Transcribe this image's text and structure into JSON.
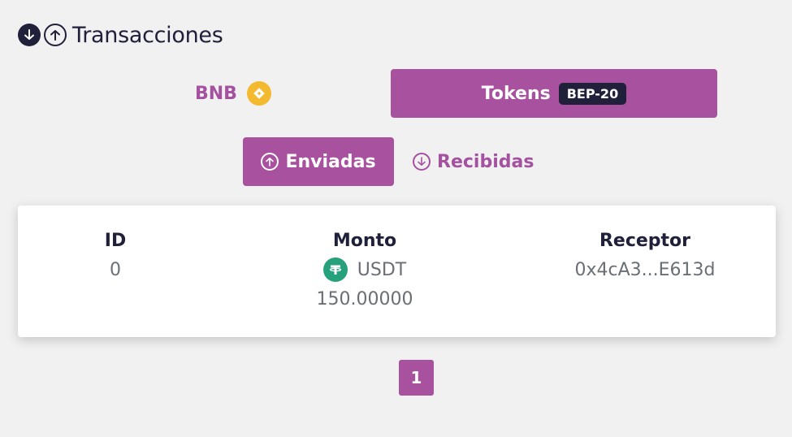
{
  "header": {
    "title": "Transacciones",
    "icons": [
      "arrow-down-circle-icon",
      "arrow-up-circle-icon"
    ]
  },
  "network_tabs": {
    "bnb_label": "BNB",
    "bnb_icon": "bnb-coin-icon",
    "tokens_label": "Tokens",
    "tokens_badge": "BEP-20",
    "active": "Tokens"
  },
  "direction_tabs": {
    "sent_label": "Enviadas",
    "received_label": "Recibidas",
    "active": "Enviadas"
  },
  "table": {
    "columns": [
      "ID",
      "Monto",
      "Receptor"
    ],
    "rows": [
      {
        "id": "0",
        "token": "USDT",
        "token_icon": "tether-icon",
        "amount": "150.00000",
        "receiver": "0x4cA3...E613d"
      }
    ]
  },
  "pagination": {
    "current_page": "1"
  },
  "colors": {
    "accent": "#a8519f",
    "dark": "#20203a",
    "muted_text": "#6a6f76",
    "bnb": "#f3ba2f",
    "tether": "#26a17b",
    "background": "#f1f1f2"
  }
}
